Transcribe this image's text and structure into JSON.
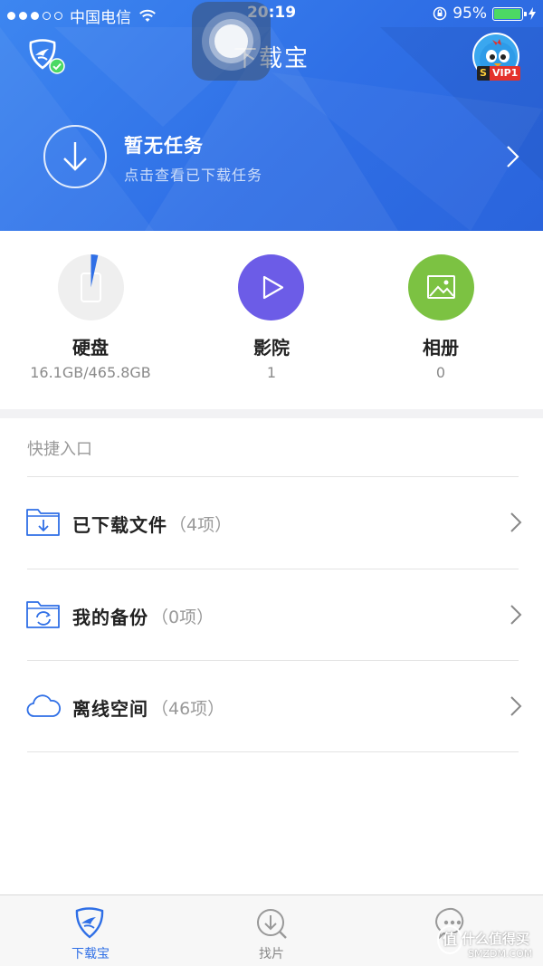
{
  "colors": {
    "brand_blue": "#2f6fe6",
    "disk_icon_bg": "#efefef",
    "cinema_icon_bg": "#6c5ce7",
    "album_icon_bg": "#7cc242",
    "verified_green": "#4cd964",
    "vip_red": "#e4312b"
  },
  "status_bar": {
    "carrier": "中国电信",
    "time": "20:19",
    "battery_percent": "95%",
    "battery_level": 0.95,
    "signal_bars_filled": 3,
    "signal_bars_total": 5
  },
  "header": {
    "title": "下载宝",
    "logo_icon": "xunlei-bird-logo-icon",
    "verified_icon": "check-badge-icon",
    "avatar_vip_badge": {
      "s": "S",
      "text": "VIP1"
    }
  },
  "task_banner": {
    "icon": "download-arrow-icon",
    "title": "暂无任务",
    "subtitle": "点击查看已下载任务",
    "chevron": "chevron-right-icon"
  },
  "stats": [
    {
      "id": "disk",
      "label": "硬盘",
      "value": "16.1GB/465.8GB",
      "icon": "disk-usage-icon",
      "used_fraction": 0.0346
    },
    {
      "id": "cinema",
      "label": "影院",
      "value": "1",
      "icon": "play-icon"
    },
    {
      "id": "album",
      "label": "相册",
      "value": "0",
      "icon": "picture-icon"
    }
  ],
  "quick_entry": {
    "title": "快捷入口",
    "items": [
      {
        "label": "已下载文件",
        "count": "（4项）",
        "icon": "download-folder-icon"
      },
      {
        "label": "我的备份",
        "count": "（0项）",
        "icon": "backup-folder-icon"
      },
      {
        "label": "离线空间",
        "count": "（46项）",
        "icon": "cloud-icon"
      }
    ]
  },
  "tabbar": {
    "tabs": [
      {
        "label": "下载宝",
        "icon": "xunlei-bird-logo-icon",
        "active": true
      },
      {
        "label": "找片",
        "icon": "search-download-icon",
        "active": false
      },
      {
        "label": "",
        "icon": "chat-bubble-icon",
        "active": false
      }
    ]
  },
  "watermark": {
    "text": "什么值得买",
    "sub": "SMZDM.COM",
    "logo": "值"
  }
}
